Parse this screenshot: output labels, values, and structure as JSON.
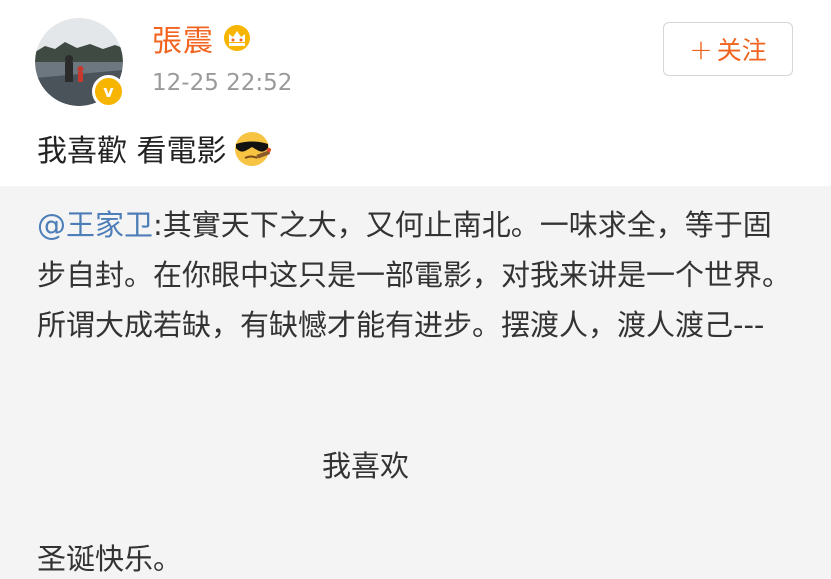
{
  "post": {
    "author": {
      "name": "張震",
      "avatar": "landscape-avatar",
      "badge_icon": "verified-badge-icon",
      "vip_icon": "crown-icon",
      "name_color": "#f0641f",
      "badge_color": "#f7b500"
    },
    "timestamp": "12-25 22:52",
    "follow_button": {
      "plus": "+",
      "label": "关注"
    },
    "text": "我喜歡 看電影",
    "emoji": "sunglasses-cigar-emoji"
  },
  "repost": {
    "mention": "@王家卫",
    "body": ":其實天下之大，又何止南北。一味求全，等于固步自封。在你眼中这只是一部電影，对我来讲是一个世界。所谓大成若缺，有缺憾才能有进步。摆渡人，渡人渡己---",
    "centered_line": "我喜欢",
    "closing_line": "圣诞快乐。",
    "mention_color": "#4e7eb8",
    "background": "#f4f4f4"
  }
}
